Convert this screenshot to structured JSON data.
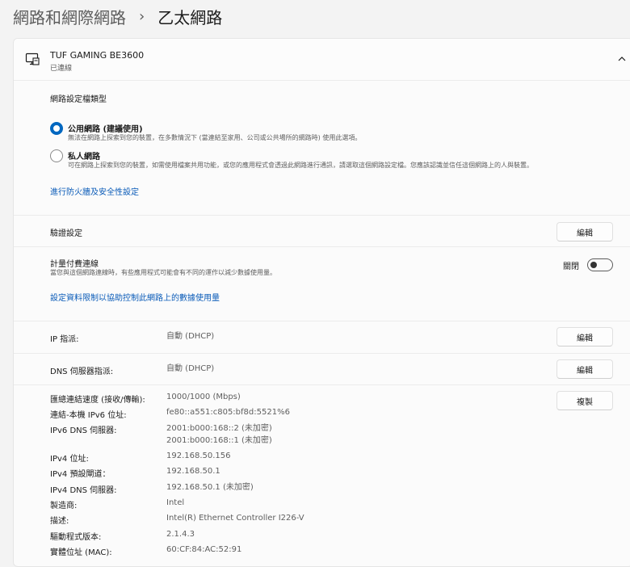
{
  "breadcrumb": {
    "parent": "網路和網際網路",
    "separator": "›",
    "current": "乙太網路"
  },
  "adapter": {
    "name": "TUF GAMING BE3600",
    "status": "已連線",
    "icon": "ethernet-monitor-icon"
  },
  "profile": {
    "label": "網路設定檔類型",
    "options": [
      {
        "title": "公用網路 (建議使用)",
        "desc": "無法在網路上探索到您的裝置，在多數情況下 (當連結至家用、公司或公共場所的網路時) 使用此選項。",
        "selected": true
      },
      {
        "title": "私人網路",
        "desc": "可在網路上探索到您的裝置，如需使用檔案共用功能，或您的應用程式會透過此網路進行通訊，請選取這個網路設定檔。您應該認識並信任這個網路上的人與裝置。",
        "selected": false
      }
    ],
    "firewall_link": "進行防火牆及安全性設定"
  },
  "auth": {
    "label": "驗證設定",
    "edit": "編輯"
  },
  "metered": {
    "label": "計量付費連線",
    "desc": "當您與這個網路連線時，有些應用程式可能會有不同的運作以減少數據使用量。",
    "toggle_label": "關閉",
    "toggle_on": false,
    "limit_link": "設定資料限制以協助控制此網路上的數據使用量"
  },
  "ip": {
    "label": "IP 指派:",
    "value": "自動 (DHCP)",
    "edit": "編輯"
  },
  "dns": {
    "label": "DNS 伺服器指派:",
    "value": "自動 (DHCP)",
    "edit": "編輯"
  },
  "properties": {
    "copy": "複製",
    "items": [
      {
        "key": "匯總連結速度 (接收/傳輸):",
        "value": "1000/1000 (Mbps)"
      },
      {
        "key": "連結-本機 IPv6 位址:",
        "value": "fe80::a551:c805:bf8d:5521%6"
      },
      {
        "key": "IPv6 DNS 伺服器:",
        "value": "2001:b000:168::2 (未加密)",
        "value2": "2001:b000:168::1 (未加密)"
      },
      {
        "key": "IPv4 位址:",
        "value": "192.168.50.156"
      },
      {
        "key": "IPv4 預設閘道：",
        "value": "192.168.50.1"
      },
      {
        "key": "IPv4 DNS 伺服器:",
        "value": "192.168.50.1 (未加密)"
      },
      {
        "key": "製造商:",
        "value": "Intel"
      },
      {
        "key": "描述:",
        "value": "Intel(R) Ethernet Controller I226-V"
      },
      {
        "key": "驅動程式版本:",
        "value": "2.1.4.3"
      },
      {
        "key": "實體位址 (MAC):",
        "value": "60:CF:84:AC:52:91"
      }
    ]
  },
  "colors": {
    "accent": "#0067c0",
    "link": "#0a5bb8"
  }
}
